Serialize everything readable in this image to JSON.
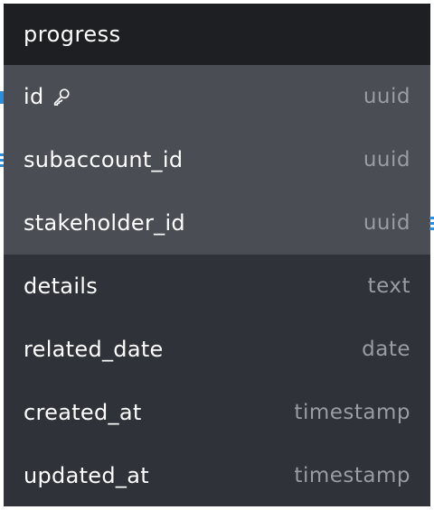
{
  "table": {
    "name": "progress",
    "columns": [
      {
        "name": "id",
        "type": "uuid",
        "primary_key": true,
        "highlighted": true
      },
      {
        "name": "subaccount_id",
        "type": "uuid",
        "highlighted": true
      },
      {
        "name": "stakeholder_id",
        "type": "uuid",
        "highlighted": true
      },
      {
        "name": "details",
        "type": "text",
        "highlighted": false
      },
      {
        "name": "related_date",
        "type": "date",
        "highlighted": false
      },
      {
        "name": "created_at",
        "type": "timestamp",
        "highlighted": false
      },
      {
        "name": "updated_at",
        "type": "timestamp",
        "highlighted": false
      }
    ]
  },
  "icons": {
    "primary_key": "key-icon"
  },
  "colors": {
    "header_bg": "#1e1f22",
    "row_highlight_bg": "#4a4d54",
    "row_bg": "#2f3238",
    "connector": "#2b8fe0",
    "type_text": "#9a9ca2"
  }
}
